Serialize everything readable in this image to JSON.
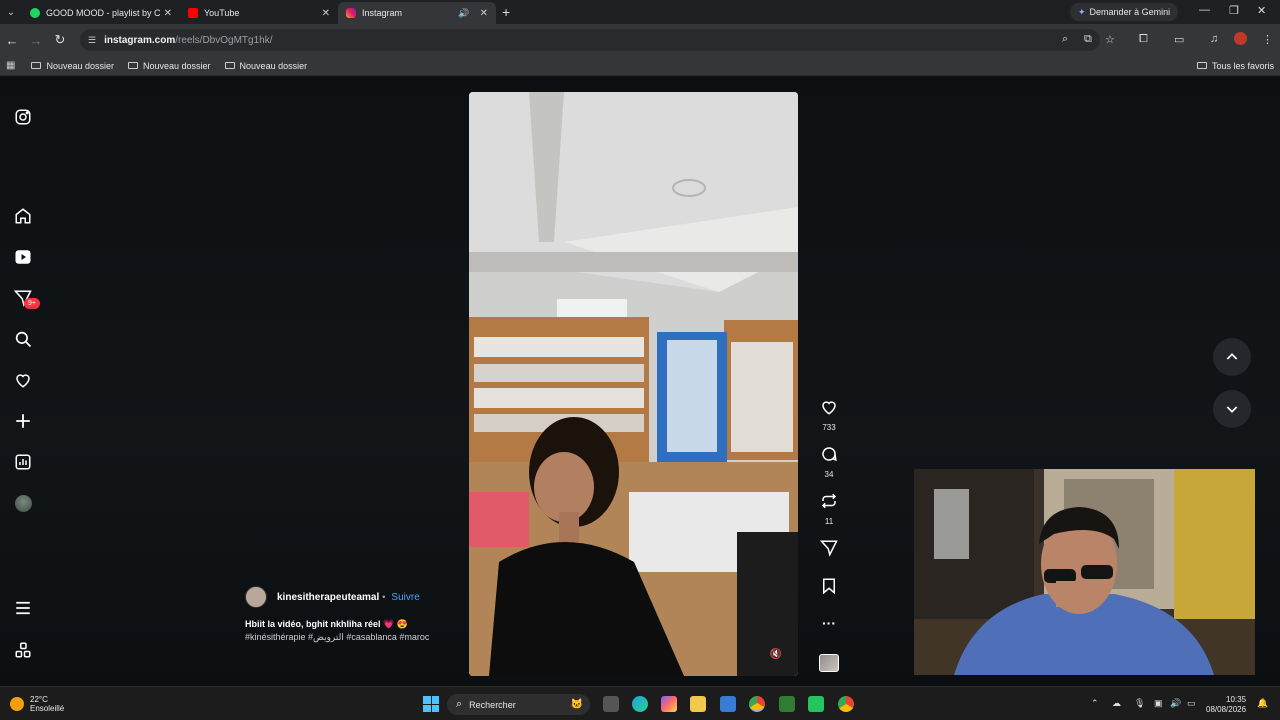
{
  "browser": {
    "tabs": [
      {
        "title": "GOOD MOOD - playlist by Cs"
      },
      {
        "title": "YouTube"
      },
      {
        "title": "Instagram"
      }
    ],
    "gemini_label": "Demander à Gemini",
    "url_host": "instagram.com",
    "url_path": "/reels/DbvOgMTg1hk/",
    "bookmarks": [
      "Nouveau dossier",
      "Nouveau dossier",
      "Nouveau dossier"
    ],
    "all_bookmarks": "Tous les favoris"
  },
  "sidebar": {
    "notifications_badge": "9+"
  },
  "reel": {
    "username": "kinesitherapeuteamal",
    "separator": "•",
    "follow_label": "Suivre",
    "caption": "Hbiit la vidéo, bghit nkhliha réel 💗 😍",
    "hashtags": "#kinésithérapie #الترويض #casablanca #maroc",
    "likes": "733",
    "comments": "34",
    "reposts": "11"
  },
  "taskbar": {
    "weather_temp": "22°C",
    "weather_desc": "Ensoleillé",
    "search_placeholder": "Rechercher",
    "time": "10:35",
    "date": "08/08/2026"
  }
}
